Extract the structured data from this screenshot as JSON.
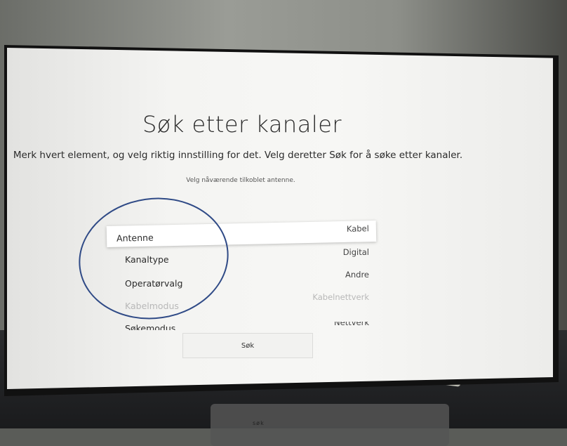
{
  "screen": {
    "title": "Søk etter kanaler",
    "description": "Merk hvert element, og velg riktig innstilling for det. Velg deretter Søk for å søke etter kanaler.",
    "hint": "Velg nåværende tilkoblet antenne."
  },
  "menu": {
    "items": [
      {
        "label": "Antenne",
        "value": "Kabel",
        "state": "focused"
      },
      {
        "label": "Kanaltype",
        "value": "Digital",
        "state": "enabled"
      },
      {
        "label": "Operatørvalg",
        "value": "Andre",
        "state": "enabled"
      },
      {
        "label": "Kabelmodus",
        "value": "Kabelnettverk",
        "state": "disabled"
      },
      {
        "label": "Søkemodus",
        "value": "Nettverk",
        "state": "partially-visible"
      }
    ]
  },
  "buttons": {
    "search_label": "Søk"
  },
  "stand": {
    "label": "søk"
  },
  "colors": {
    "annotation": "#2f4a86",
    "screen_bg": "#f4f4f2"
  }
}
